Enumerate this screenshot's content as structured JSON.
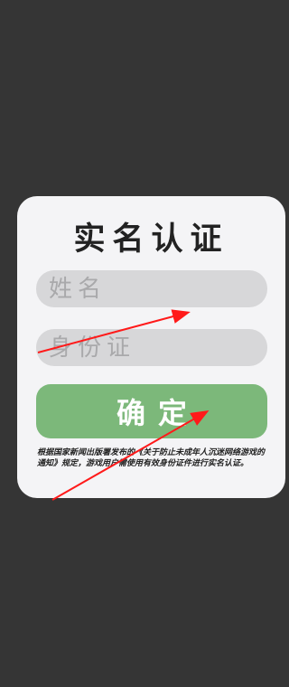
{
  "dialog": {
    "title": "实名认证",
    "name_placeholder": "姓名",
    "id_placeholder": "身份证",
    "name_value": "",
    "id_value": "",
    "confirm_label": "确定",
    "notice": "根据国家新闻出版署发布的《关于防止未成年人沉迷网络游戏的通知》规定，游戏用户需使用有效身份证件进行实名认证。"
  },
  "colors": {
    "background": "#353535",
    "dialog_background": "#f4f4f6",
    "field_background": "#d7d7d9",
    "confirm_button": "#7cb87a",
    "annotation_arrow": "#ff1a1a"
  },
  "annotations": {
    "arrow_icon": "red-arrow-icon"
  }
}
